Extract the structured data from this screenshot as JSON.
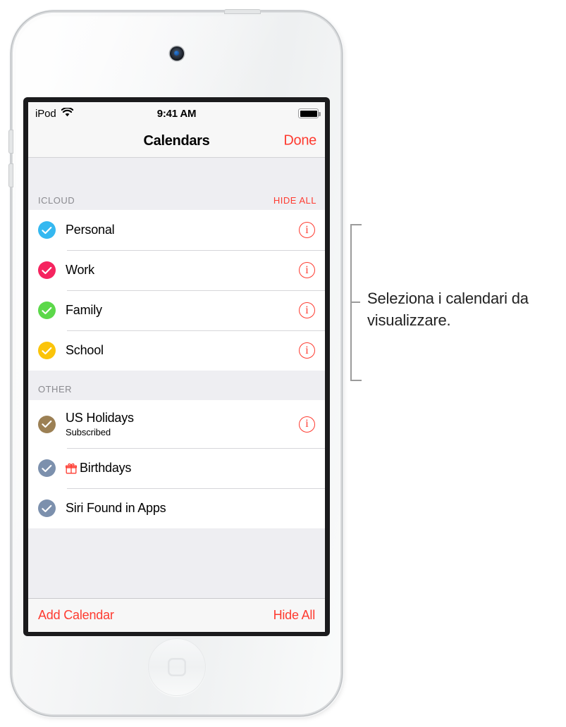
{
  "device": {
    "type": "ipod-touch",
    "camera": "front-camera",
    "home_button": "home-button"
  },
  "status_bar": {
    "carrier": "iPod",
    "wifi_icon": "wifi-icon",
    "time": "9:41 AM",
    "battery_icon": "battery-full-icon"
  },
  "nav_bar": {
    "title": "Calendars",
    "done_label": "Done"
  },
  "sections": [
    {
      "title": "ICLOUD",
      "action_label": "HIDE ALL",
      "rows": [
        {
          "label": "Personal",
          "subtitle": "",
          "color": "#35b8f0",
          "checked": true,
          "info": "i",
          "prefix_icon": ""
        },
        {
          "label": "Work",
          "subtitle": "",
          "color": "#f5245f",
          "checked": true,
          "info": "i",
          "prefix_icon": ""
        },
        {
          "label": "Family",
          "subtitle": "",
          "color": "#5cd84a",
          "checked": true,
          "info": "i",
          "prefix_icon": ""
        },
        {
          "label": "School",
          "subtitle": "",
          "color": "#fbc40a",
          "checked": true,
          "info": "i",
          "prefix_icon": ""
        }
      ]
    },
    {
      "title": "OTHER",
      "action_label": "",
      "rows": [
        {
          "label": "US Holidays",
          "subtitle": "Subscribed",
          "color": "#9c8054",
          "checked": true,
          "info": "i",
          "prefix_icon": ""
        },
        {
          "label": "Birthdays",
          "subtitle": "",
          "color": "#7c90ad",
          "checked": true,
          "info": "",
          "prefix_icon": "gift-icon"
        },
        {
          "label": "Siri Found in Apps",
          "subtitle": "",
          "color": "#7c90ad",
          "checked": true,
          "info": "",
          "prefix_icon": ""
        }
      ]
    }
  ],
  "toolbar": {
    "add_label": "Add Calendar",
    "hide_all_label": "Hide All"
  },
  "callout": {
    "text": "Seleziona i calendari da visualizzare."
  },
  "colors": {
    "accent_red": "#fe3b30",
    "section_bg": "#eeeef2",
    "bar_bg": "#f7f7f7",
    "separator": "#d6d6da"
  }
}
